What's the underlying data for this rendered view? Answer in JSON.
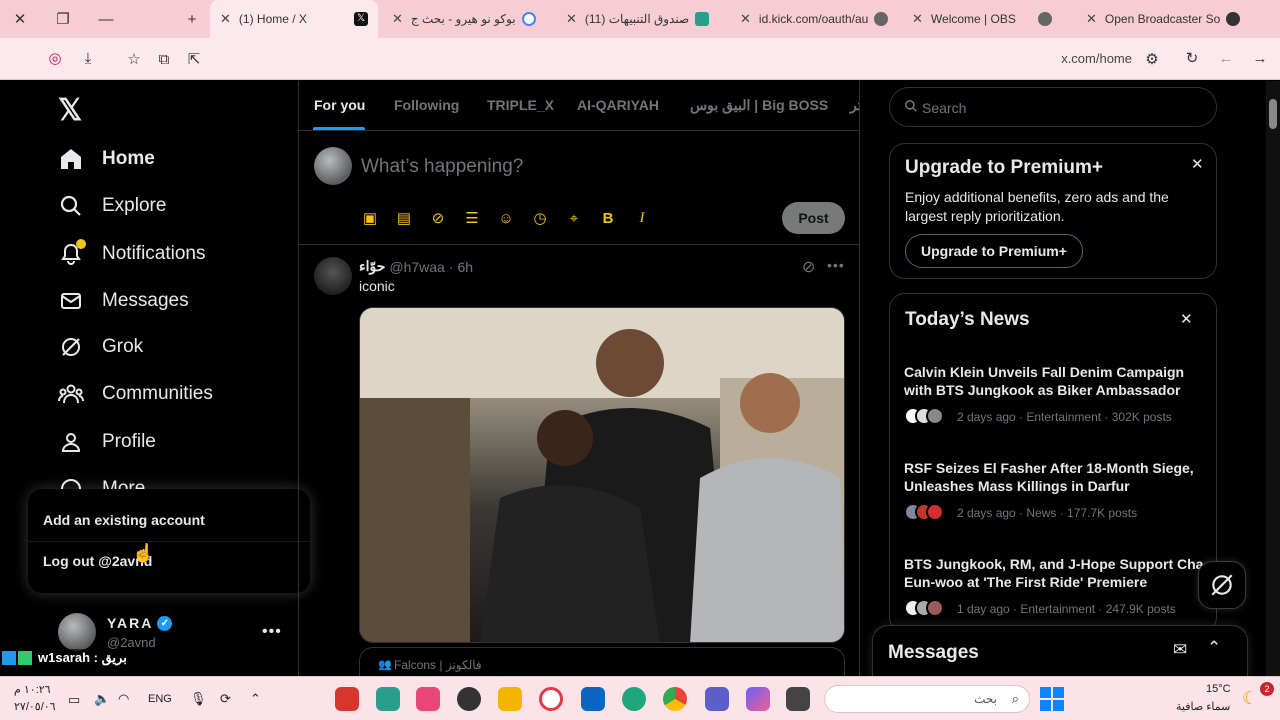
{
  "browser": {
    "tabs": [
      {
        "title": "(1) Home / X",
        "active": true
      },
      {
        "title": "بوكو نو هيرو - بحث ج"
      },
      {
        "title": "(11) صندوق التنبيهات"
      },
      {
        "title": "id.kick.com/oauth/au"
      },
      {
        "title": "Welcome | OBS"
      },
      {
        "title": "Open Broadcaster So"
      }
    ],
    "url": "x.com/home"
  },
  "sidebar": {
    "items": [
      {
        "label": "Home",
        "icon": "home-icon"
      },
      {
        "label": "Explore",
        "icon": "search-icon"
      },
      {
        "label": "Notifications",
        "icon": "bell-icon"
      },
      {
        "label": "Messages",
        "icon": "mail-icon"
      },
      {
        "label": "Grok",
        "icon": "grok-icon"
      },
      {
        "label": "Communities",
        "icon": "communities-icon"
      },
      {
        "label": "Profile",
        "icon": "profile-icon"
      },
      {
        "label": "More",
        "icon": "more-icon"
      }
    ],
    "account": {
      "name": "YARA",
      "handle": "@2avnd"
    }
  },
  "account_menu": {
    "add": "Add an existing account",
    "logout": "Log out @2avnd"
  },
  "feed_tabs": [
    "For you",
    "Following",
    "TRIPLE_X",
    "AI-QARIYAH",
    "البيق بوس | Big BOSS",
    "تر"
  ],
  "compose": {
    "placeholder": "What’s happening?",
    "post_label": "Post"
  },
  "tweet": {
    "author": "حوّاء",
    "handle": "@h7waa",
    "time": "6h",
    "text": "iconic",
    "community": "Falcons | فالكونز"
  },
  "search": {
    "placeholder": "Search"
  },
  "premium": {
    "title": "Upgrade to Premium+",
    "body": "Enjoy additional benefits, zero ads and the largest reply prioritization.",
    "button": "Upgrade to Premium+"
  },
  "news": {
    "title": "Today’s News",
    "items": [
      {
        "headline": "Calvin Klein Unveils Fall Denim Campaign with BTS Jungkook as Biker Ambassador",
        "meta": "2 days ago · Entertainment · 302K posts"
      },
      {
        "headline": "RSF Seizes El Fasher After 18-Month Siege, Unleashes Mass Killings in Darfur",
        "meta": "2 days ago · News · 177.7K posts"
      },
      {
        "headline": "BTS Jungkook, RM, and J-Hope Support Cha Eun-woo at 'The First Ride' Premiere",
        "meta": "1 day ago · Entertainment · 247.9K posts"
      }
    ]
  },
  "messages_drawer": {
    "title": "Messages"
  },
  "overlay": {
    "chat": "w1sarah : بريق"
  },
  "taskbar": {
    "time": "١٠:٢٦ م",
    "date": "٢٧/٠٥/٠٦",
    "lang": "ENG",
    "search_placeholder": "بحث",
    "temp": "15°C",
    "weather": "سماء صافية",
    "badge": "2"
  },
  "colors": {
    "accent": "#1d9bf0",
    "tool_yellow": "#f0c419",
    "tab_pink": "#f6cdd4",
    "verified": "#1d9bf0"
  }
}
